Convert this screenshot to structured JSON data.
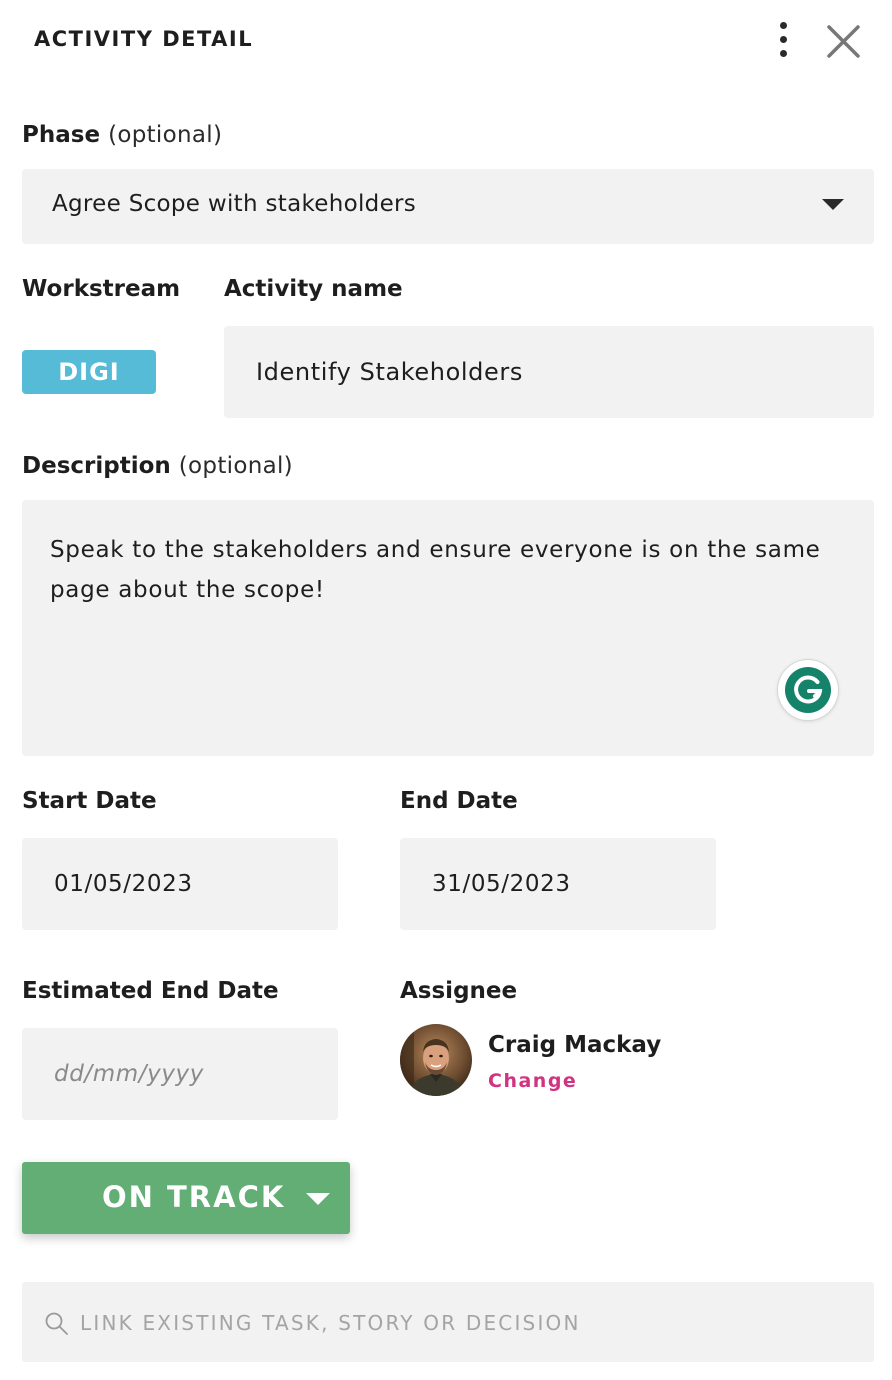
{
  "header": {
    "title": "ACTIVITY DETAIL",
    "more_icon": "more-vertical-icon",
    "close_icon": "close-icon"
  },
  "phase": {
    "label": "Phase",
    "optional": "(optional)",
    "value": "Agree Scope with stakeholders"
  },
  "workstream": {
    "label": "Workstream",
    "badge": "DIGI",
    "badge_color": "#55bbd7"
  },
  "activity": {
    "label": "Activity name",
    "value": "Identify Stakeholders"
  },
  "description": {
    "label": "Description",
    "optional": "(optional)",
    "value": "Speak to the stakeholders and ensure everyone is on the same page about the scope!"
  },
  "start_date": {
    "label": "Start Date",
    "value": "01/05/2023"
  },
  "end_date": {
    "label": "End Date",
    "value": "31/05/2023"
  },
  "estimated_end_date": {
    "label": "Estimated End Date",
    "placeholder": "dd/mm/yyyy"
  },
  "assignee": {
    "label": "Assignee",
    "name": "Craig Mackay",
    "change": "Change"
  },
  "status": {
    "label": "ON TRACK",
    "color": "#62ae74"
  },
  "link_search": {
    "placeholder": "LINK EXISTING TASK, STORY OR DECISION",
    "icon": "search-icon"
  },
  "colors": {
    "accent_pink": "#d0337f",
    "field_background": "#f2f2f2",
    "grammarly_green": "#15826a"
  }
}
